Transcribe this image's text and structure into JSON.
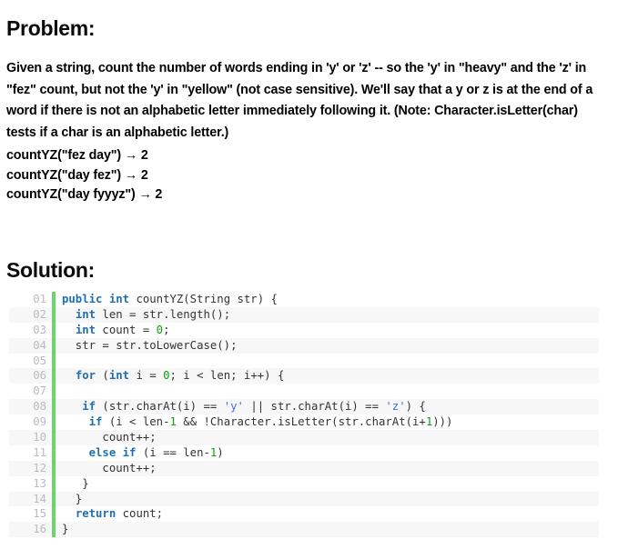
{
  "problem": {
    "heading": "Problem:",
    "statement": "Given a string, count the number of words ending in 'y' or 'z' -- so the 'y' in \"heavy\" and the 'z' in \"fez\" count, but not the 'y' in \"yellow\" (not case sensitive). We'll say that a y or z is at the end of a word if there is not an alphabetic letter immediately following it. (Note: Character.isLetter(char) tests if a char is an alphabetic letter.)",
    "examples": [
      "countYZ(\"fez day\") → 2",
      "countYZ(\"day fez\") → 2",
      "countYZ(\"day fyyyz\") → 2"
    ]
  },
  "solution": {
    "heading": "Solution:",
    "language": "java",
    "colors": {
      "keyword": "#1f6fb2",
      "number": "#12a012",
      "string": "#3a6ee8",
      "plain": "#333333",
      "line_number": "#b9bcc0",
      "gutter_bar": "#6ed46e",
      "stripe": "#f7f7f7"
    },
    "code_lines": [
      {
        "no": "01",
        "tokens": [
          {
            "t": "public",
            "c": "kw"
          },
          {
            "t": " ",
            "c": "pl"
          },
          {
            "t": "int",
            "c": "kw"
          },
          {
            "t": " countYZ(String str) {",
            "c": "pl"
          }
        ]
      },
      {
        "no": "02",
        "tokens": [
          {
            "t": "  ",
            "c": "pl"
          },
          {
            "t": "int",
            "c": "kw"
          },
          {
            "t": " len = str.length();",
            "c": "pl"
          }
        ]
      },
      {
        "no": "03",
        "tokens": [
          {
            "t": "  ",
            "c": "pl"
          },
          {
            "t": "int",
            "c": "kw"
          },
          {
            "t": " count = ",
            "c": "pl"
          },
          {
            "t": "0",
            "c": "num"
          },
          {
            "t": ";",
            "c": "pl"
          }
        ]
      },
      {
        "no": "04",
        "tokens": [
          {
            "t": "  str = str.toLowerCase();",
            "c": "pl"
          }
        ]
      },
      {
        "no": "05",
        "tokens": [
          {
            "t": "",
            "c": "pl"
          }
        ]
      },
      {
        "no": "06",
        "tokens": [
          {
            "t": "  ",
            "c": "pl"
          },
          {
            "t": "for",
            "c": "kw"
          },
          {
            "t": " (",
            "c": "pl"
          },
          {
            "t": "int",
            "c": "kw"
          },
          {
            "t": " i = ",
            "c": "pl"
          },
          {
            "t": "0",
            "c": "num"
          },
          {
            "t": "; i < len; i++) {",
            "c": "pl"
          }
        ]
      },
      {
        "no": "07",
        "tokens": [
          {
            "t": "",
            "c": "pl"
          }
        ]
      },
      {
        "no": "08",
        "tokens": [
          {
            "t": "   ",
            "c": "pl"
          },
          {
            "t": "if",
            "c": "kw"
          },
          {
            "t": " (str.charAt(i) == ",
            "c": "pl"
          },
          {
            "t": "'y'",
            "c": "str"
          },
          {
            "t": " || str.charAt(i) == ",
            "c": "pl"
          },
          {
            "t": "'z'",
            "c": "str"
          },
          {
            "t": ") {",
            "c": "pl"
          }
        ]
      },
      {
        "no": "09",
        "tokens": [
          {
            "t": "    ",
            "c": "pl"
          },
          {
            "t": "if",
            "c": "kw"
          },
          {
            "t": " (i < len-",
            "c": "pl"
          },
          {
            "t": "1",
            "c": "num"
          },
          {
            "t": " && !Character.isLetter(str.charAt(i+",
            "c": "pl"
          },
          {
            "t": "1",
            "c": "num"
          },
          {
            "t": ")))",
            "c": "pl"
          }
        ]
      },
      {
        "no": "10",
        "tokens": [
          {
            "t": "      count++;",
            "c": "pl"
          }
        ]
      },
      {
        "no": "11",
        "tokens": [
          {
            "t": "    ",
            "c": "pl"
          },
          {
            "t": "else if",
            "c": "kw"
          },
          {
            "t": " (i == len-",
            "c": "pl"
          },
          {
            "t": "1",
            "c": "num"
          },
          {
            "t": ")",
            "c": "pl"
          }
        ]
      },
      {
        "no": "12",
        "tokens": [
          {
            "t": "      count++;",
            "c": "pl"
          }
        ]
      },
      {
        "no": "13",
        "tokens": [
          {
            "t": "   }",
            "c": "pl"
          }
        ]
      },
      {
        "no": "14",
        "tokens": [
          {
            "t": "  }",
            "c": "pl"
          }
        ]
      },
      {
        "no": "15",
        "tokens": [
          {
            "t": "  ",
            "c": "pl"
          },
          {
            "t": "return",
            "c": "kw"
          },
          {
            "t": " count;",
            "c": "pl"
          }
        ]
      },
      {
        "no": "16",
        "tokens": [
          {
            "t": "}",
            "c": "pl"
          }
        ]
      }
    ]
  }
}
